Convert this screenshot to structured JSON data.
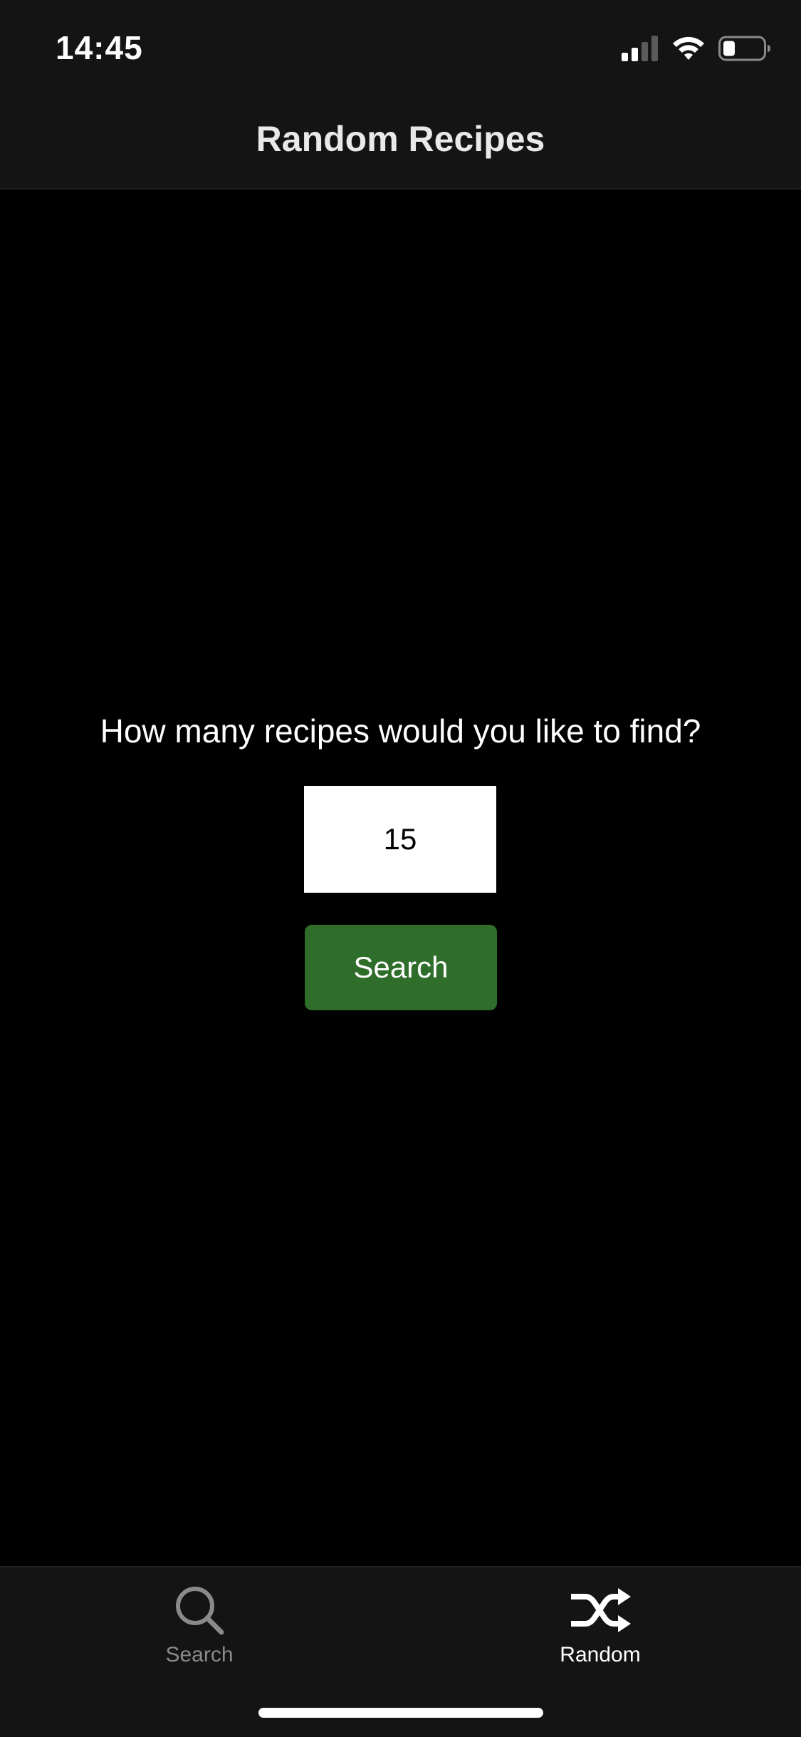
{
  "status_bar": {
    "time": "14:45",
    "icons": [
      "cellular-signal-icon",
      "wifi-icon",
      "battery-icon"
    ]
  },
  "header": {
    "title": "Random Recipes"
  },
  "main": {
    "prompt": "How many recipes would you like to find?",
    "count_input": {
      "value": "15",
      "placeholder": ""
    },
    "search_button_label": "Search",
    "search_button_color": "#2e6e2a"
  },
  "tab_bar": {
    "tabs": [
      {
        "label": "Search",
        "icon": "search-icon",
        "active": false
      },
      {
        "label": "Random",
        "icon": "shuffle-icon",
        "active": true
      }
    ],
    "active_color": "#ffffff",
    "inactive_color": "#8a8a8a"
  }
}
